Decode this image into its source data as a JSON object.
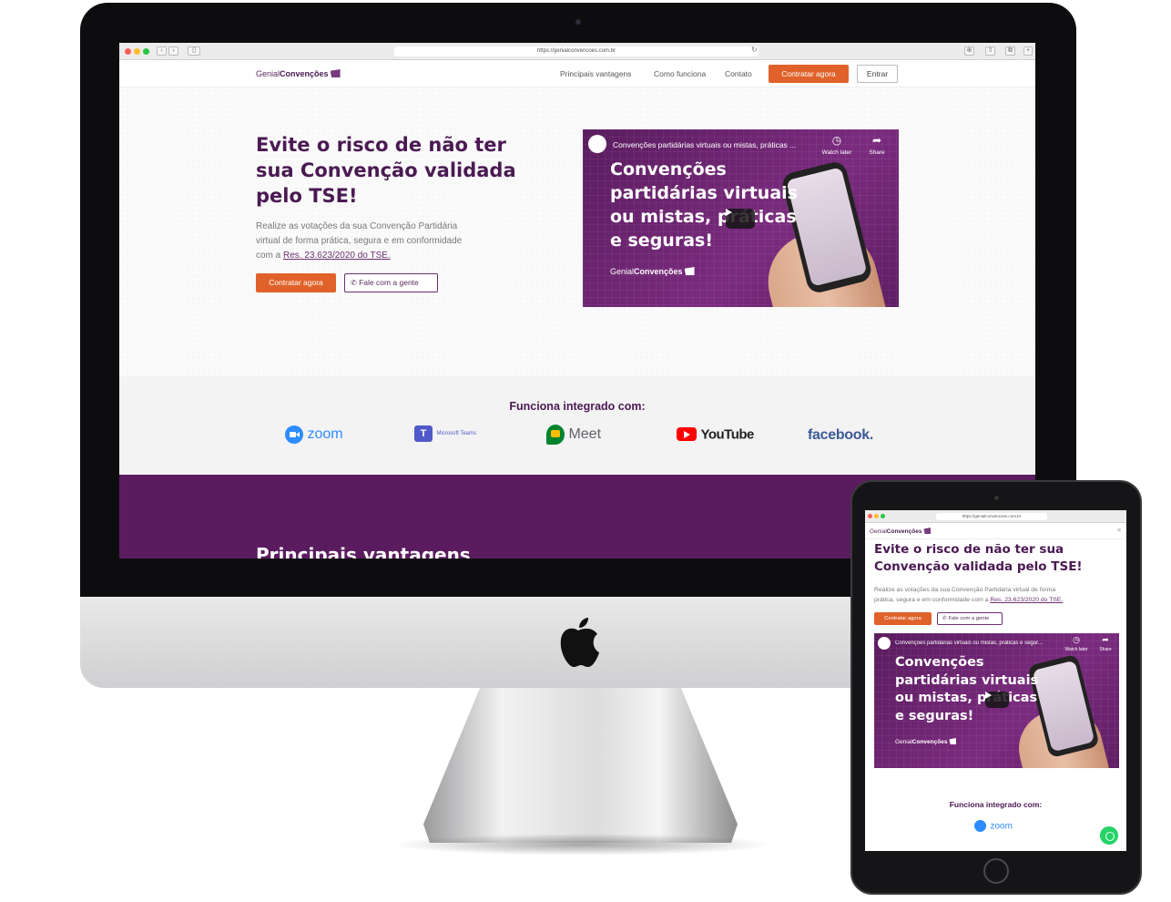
{
  "browser": {
    "url": "https://genialconvencoes.com.br"
  },
  "site": {
    "logo_light": "Genial",
    "logo_bold": "Convenções",
    "nav": {
      "link1": "Principais vantagens",
      "link2": "Como funciona",
      "link3": "Contato",
      "cta": "Contratar agora",
      "login": "Entrar"
    },
    "hero": {
      "title_line1": "Evite o risco de não ter",
      "title_line2": "sua Convenção validada",
      "title_line3": "pelo TSE!",
      "title_tablet_line1": "Evite o risco de não ter sua",
      "title_tablet_line2": "Convenção validada pelo TSE!",
      "text_line1": "Realize as votações da sua Convenção Partidária",
      "text_line2": "virtual de forma prática, segura e em conformidade",
      "text_line3_prefix": "com a ",
      "text_link": "Res. 23.623/2020 do TSE.",
      "text_tablet_line1": "Realize as votações da sua Convenção Partidária virtual de forma",
      "text_tablet_line2_prefix": "prática, segura e em conformidade com a ",
      "primary_button": "Contratar agora",
      "secondary_button": "Fale com a gente"
    },
    "video": {
      "title": "Convenções partidárias virtuais ou mistas, práticas ...",
      "title_tablet": "Convenções partidárias virtuais ou mistas, práticas e segur...",
      "headline_line1": "Convenções",
      "headline_line2": "partidárias virtuais",
      "headline_line3": "ou mistas, práticas",
      "headline_line4": "e seguras!",
      "watch_later": "Watch later",
      "share": "Share",
      "brand_light": "Genial",
      "brand_bold": "Convenções"
    },
    "integrations": {
      "title": "Funciona integrado com:",
      "zoom": "zoom",
      "teams": "Microsoft Teams",
      "meet": "Meet",
      "youtube": "YouTube",
      "facebook": "facebook."
    },
    "next_section_title": "Principais vantagens"
  },
  "colors": {
    "brand_purple": "#5a1c5f",
    "cta_orange": "#e0622a",
    "zoom_blue": "#2d8cff",
    "teams_purple": "#5059c9",
    "meet_green": "#00832d",
    "youtube_red": "#ff0000",
    "facebook_blue": "#3b5998"
  }
}
